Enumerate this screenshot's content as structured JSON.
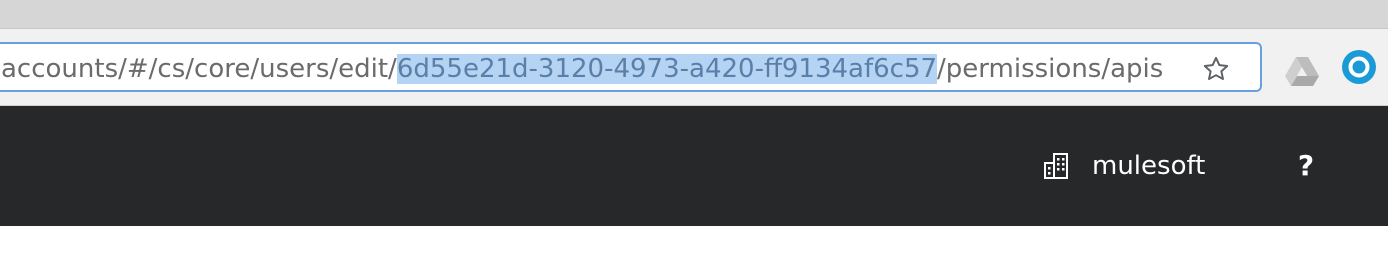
{
  "browser": {
    "url_prefix": "accounts/#/cs/core/users/edit/",
    "url_selected": "6d55e21d-3120-4973-a420-ff9134af6c57",
    "url_suffix": "/permissions/apis",
    "icons": {
      "bookmark": "star-icon",
      "extension_1": "google-drive-icon",
      "extension_2": "circle-extension-icon"
    },
    "colors": {
      "focus_border": "#6aa0dd",
      "selection": "#b5d3f3",
      "extension_circle": "#1a9bd7"
    }
  },
  "appbar": {
    "org_name": "mulesoft",
    "help_label": "?",
    "icons": {
      "org": "building-icon",
      "help": "question-icon"
    },
    "colors": {
      "background": "#27282a"
    }
  }
}
